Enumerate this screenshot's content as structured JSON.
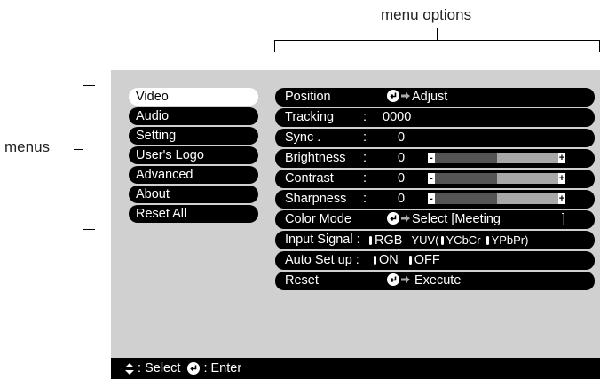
{
  "annotations": {
    "menu_options_label": "menu options",
    "menus_label": "menus"
  },
  "menus": [
    {
      "label": "Video",
      "active": true
    },
    {
      "label": "Audio",
      "active": false
    },
    {
      "label": "Setting",
      "active": false
    },
    {
      "label": "User's Logo",
      "active": false
    },
    {
      "label": "Advanced",
      "active": false
    },
    {
      "label": "About",
      "active": false
    },
    {
      "label": "Reset All",
      "active": false
    }
  ],
  "options": {
    "position": {
      "label": "Position",
      "value": "Adjust"
    },
    "tracking": {
      "label": "Tracking",
      "colon": ":",
      "value": "0000"
    },
    "sync": {
      "label": "Sync .",
      "colon": ":",
      "value": "0"
    },
    "brightness": {
      "label": "Brightness",
      "colon": ":",
      "value": "0",
      "level": 0.5
    },
    "contrast": {
      "label": "Contrast",
      "colon": ":",
      "value": "0",
      "level": 0.5
    },
    "sharpness": {
      "label": "Sharpness",
      "colon": ":",
      "value": "0",
      "level": 0.5
    },
    "color_mode": {
      "label": "Color Mode",
      "value": "Select [Meeting",
      "close": "]"
    },
    "input_signal": {
      "label": "Input Signal :",
      "opt1": "RGB",
      "opt2": "YUV(",
      "opt3": "YCbCr",
      "opt4": "YPbPr)"
    },
    "auto_setup": {
      "label": "Auto Set up :",
      "on": "ON",
      "off": "OFF"
    },
    "reset": {
      "label": "Reset",
      "value": "Execute"
    }
  },
  "slider_marks": {
    "minus": "-",
    "plus": "+"
  },
  "bottom_bar": {
    "select_label": ": Select",
    "enter_label": ": Enter"
  },
  "colors": {
    "screen_bg": "#d0d0d0",
    "bar_bg": "#000000",
    "active_bg": "#ffffff"
  }
}
